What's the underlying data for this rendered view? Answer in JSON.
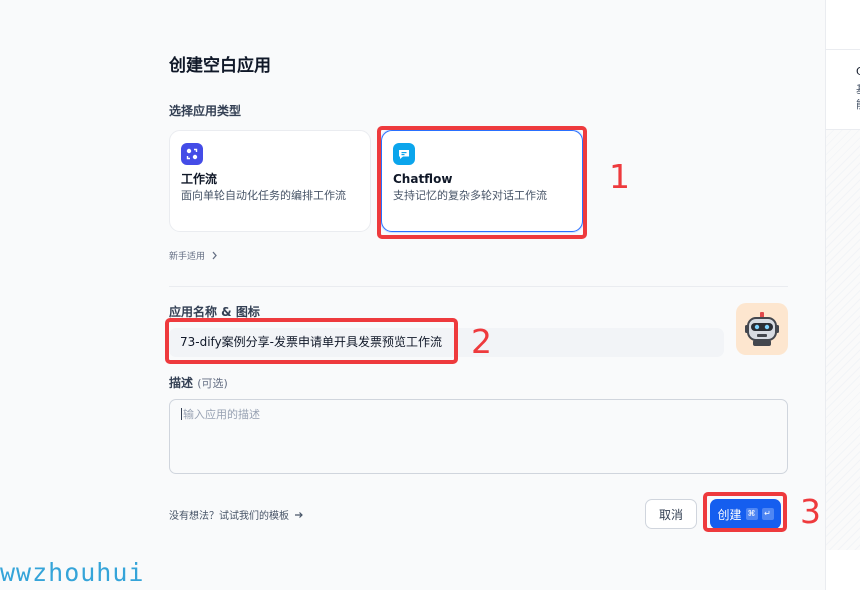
{
  "dialog": {
    "title": "创建空白应用",
    "type_section_label": "选择应用类型",
    "app_types": [
      {
        "title": "工作流",
        "desc": "面向单轮自动化任务的编排工作流",
        "icon": "workflow-icon",
        "color": "#444ce7"
      },
      {
        "title": "Chatflow",
        "desc": "支持记忆的复杂多轮对话工作流",
        "icon": "chat-bubble-icon",
        "color": "#0ba5ec"
      }
    ],
    "guide_link": "新手适用",
    "name_label": "应用名称 & 图标",
    "name_value": "73-dify案例分享-发票申请单开具发票预览工作流",
    "desc_label": "描述",
    "desc_optional": "(可选)",
    "desc_placeholder": "输入应用的描述",
    "template_link": "没有想法？试试我们的模板",
    "cancel_label": "取消",
    "create_label": "创建",
    "create_shortcut_cmd": "⌘",
    "create_shortcut_enter": "↵"
  },
  "side_panel": {
    "line1": "C",
    "line2": "基",
    "line3": "能"
  },
  "annotations": {
    "n1": "1",
    "n2": "2",
    "n3": "3"
  },
  "watermark": "wwzhouhui",
  "colors": {
    "accent": "#155eef",
    "annotation": "#ee3a3d",
    "watermark": "#35a4d9"
  }
}
